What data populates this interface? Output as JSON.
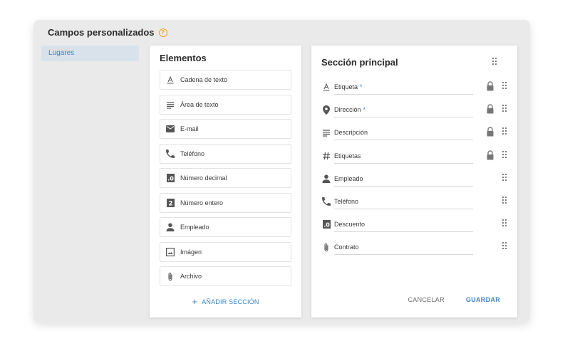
{
  "header": {
    "title": "Campos personalizados",
    "help_icon": "?"
  },
  "sidebar": {
    "items": [
      {
        "label": "Lugares",
        "selected": true
      }
    ]
  },
  "elements_panel": {
    "title": "Elementos",
    "items": [
      {
        "label": "Cadena de texto",
        "icon": "text-string-icon"
      },
      {
        "label": "Área de texto",
        "icon": "text-area-icon"
      },
      {
        "label": "E-mail",
        "icon": "email-icon"
      },
      {
        "label": "Teléfono",
        "icon": "phone-icon"
      },
      {
        "label": "Número decimal",
        "icon": "decimal-number-icon"
      },
      {
        "label": "Número entero",
        "icon": "integer-number-icon"
      },
      {
        "label": "Empleado",
        "icon": "person-icon"
      },
      {
        "label": "Imágen",
        "icon": "image-icon"
      },
      {
        "label": "Archivo",
        "icon": "attachment-icon"
      }
    ],
    "add_section_label": "AÑADIR SECCIÓN"
  },
  "section_panel": {
    "title": "Sección principal",
    "fields": [
      {
        "label": "Etiqueta",
        "required": "*",
        "icon": "text-string-icon",
        "locked": true
      },
      {
        "label": "Dirección",
        "required": "*",
        "icon": "location-pin-icon",
        "locked": true
      },
      {
        "label": "Descripción",
        "required": "",
        "icon": "text-area-icon",
        "locked": true
      },
      {
        "label": "Etiquetas",
        "required": "",
        "icon": "hashtag-icon",
        "locked": true
      },
      {
        "label": "Empleado",
        "required": "",
        "icon": "person-icon",
        "locked": false
      },
      {
        "label": "Teléfono",
        "required": "",
        "icon": "phone-icon",
        "locked": false
      },
      {
        "label": "Descuento",
        "required": "",
        "icon": "decimal-number-icon",
        "locked": false
      },
      {
        "label": "Contrato",
        "required": "",
        "icon": "attachment-icon",
        "locked": false
      }
    ],
    "cancel_label": "CANCELAR",
    "save_label": "GUARDAR"
  },
  "colors": {
    "accent": "#3b83c6",
    "help": "#f2a11f",
    "window_bg": "#eaeaea",
    "selected_bg": "#d9e2ea"
  }
}
